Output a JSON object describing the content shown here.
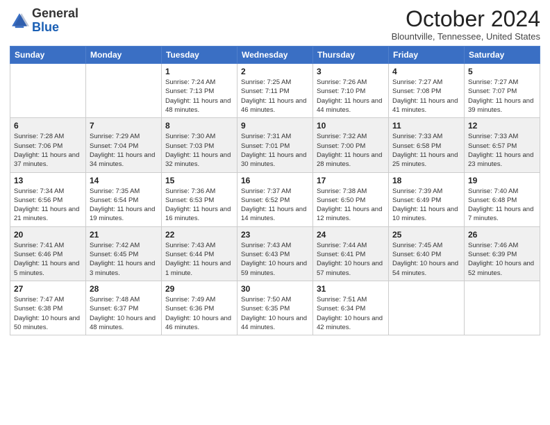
{
  "header": {
    "logo_general": "General",
    "logo_blue": "Blue",
    "month": "October 2024",
    "location": "Blountville, Tennessee, United States"
  },
  "weekdays": [
    "Sunday",
    "Monday",
    "Tuesday",
    "Wednesday",
    "Thursday",
    "Friday",
    "Saturday"
  ],
  "weeks": [
    [
      {
        "day": "",
        "info": ""
      },
      {
        "day": "",
        "info": ""
      },
      {
        "day": "1",
        "info": "Sunrise: 7:24 AM\nSunset: 7:13 PM\nDaylight: 11 hours and 48 minutes."
      },
      {
        "day": "2",
        "info": "Sunrise: 7:25 AM\nSunset: 7:11 PM\nDaylight: 11 hours and 46 minutes."
      },
      {
        "day": "3",
        "info": "Sunrise: 7:26 AM\nSunset: 7:10 PM\nDaylight: 11 hours and 44 minutes."
      },
      {
        "day": "4",
        "info": "Sunrise: 7:27 AM\nSunset: 7:08 PM\nDaylight: 11 hours and 41 minutes."
      },
      {
        "day": "5",
        "info": "Sunrise: 7:27 AM\nSunset: 7:07 PM\nDaylight: 11 hours and 39 minutes."
      }
    ],
    [
      {
        "day": "6",
        "info": "Sunrise: 7:28 AM\nSunset: 7:06 PM\nDaylight: 11 hours and 37 minutes."
      },
      {
        "day": "7",
        "info": "Sunrise: 7:29 AM\nSunset: 7:04 PM\nDaylight: 11 hours and 34 minutes."
      },
      {
        "day": "8",
        "info": "Sunrise: 7:30 AM\nSunset: 7:03 PM\nDaylight: 11 hours and 32 minutes."
      },
      {
        "day": "9",
        "info": "Sunrise: 7:31 AM\nSunset: 7:01 PM\nDaylight: 11 hours and 30 minutes."
      },
      {
        "day": "10",
        "info": "Sunrise: 7:32 AM\nSunset: 7:00 PM\nDaylight: 11 hours and 28 minutes."
      },
      {
        "day": "11",
        "info": "Sunrise: 7:33 AM\nSunset: 6:58 PM\nDaylight: 11 hours and 25 minutes."
      },
      {
        "day": "12",
        "info": "Sunrise: 7:33 AM\nSunset: 6:57 PM\nDaylight: 11 hours and 23 minutes."
      }
    ],
    [
      {
        "day": "13",
        "info": "Sunrise: 7:34 AM\nSunset: 6:56 PM\nDaylight: 11 hours and 21 minutes."
      },
      {
        "day": "14",
        "info": "Sunrise: 7:35 AM\nSunset: 6:54 PM\nDaylight: 11 hours and 19 minutes."
      },
      {
        "day": "15",
        "info": "Sunrise: 7:36 AM\nSunset: 6:53 PM\nDaylight: 11 hours and 16 minutes."
      },
      {
        "day": "16",
        "info": "Sunrise: 7:37 AM\nSunset: 6:52 PM\nDaylight: 11 hours and 14 minutes."
      },
      {
        "day": "17",
        "info": "Sunrise: 7:38 AM\nSunset: 6:50 PM\nDaylight: 11 hours and 12 minutes."
      },
      {
        "day": "18",
        "info": "Sunrise: 7:39 AM\nSunset: 6:49 PM\nDaylight: 11 hours and 10 minutes."
      },
      {
        "day": "19",
        "info": "Sunrise: 7:40 AM\nSunset: 6:48 PM\nDaylight: 11 hours and 7 minutes."
      }
    ],
    [
      {
        "day": "20",
        "info": "Sunrise: 7:41 AM\nSunset: 6:46 PM\nDaylight: 11 hours and 5 minutes."
      },
      {
        "day": "21",
        "info": "Sunrise: 7:42 AM\nSunset: 6:45 PM\nDaylight: 11 hours and 3 minutes."
      },
      {
        "day": "22",
        "info": "Sunrise: 7:43 AM\nSunset: 6:44 PM\nDaylight: 11 hours and 1 minute."
      },
      {
        "day": "23",
        "info": "Sunrise: 7:43 AM\nSunset: 6:43 PM\nDaylight: 10 hours and 59 minutes."
      },
      {
        "day": "24",
        "info": "Sunrise: 7:44 AM\nSunset: 6:41 PM\nDaylight: 10 hours and 57 minutes."
      },
      {
        "day": "25",
        "info": "Sunrise: 7:45 AM\nSunset: 6:40 PM\nDaylight: 10 hours and 54 minutes."
      },
      {
        "day": "26",
        "info": "Sunrise: 7:46 AM\nSunset: 6:39 PM\nDaylight: 10 hours and 52 minutes."
      }
    ],
    [
      {
        "day": "27",
        "info": "Sunrise: 7:47 AM\nSunset: 6:38 PM\nDaylight: 10 hours and 50 minutes."
      },
      {
        "day": "28",
        "info": "Sunrise: 7:48 AM\nSunset: 6:37 PM\nDaylight: 10 hours and 48 minutes."
      },
      {
        "day": "29",
        "info": "Sunrise: 7:49 AM\nSunset: 6:36 PM\nDaylight: 10 hours and 46 minutes."
      },
      {
        "day": "30",
        "info": "Sunrise: 7:50 AM\nSunset: 6:35 PM\nDaylight: 10 hours and 44 minutes."
      },
      {
        "day": "31",
        "info": "Sunrise: 7:51 AM\nSunset: 6:34 PM\nDaylight: 10 hours and 42 minutes."
      },
      {
        "day": "",
        "info": ""
      },
      {
        "day": "",
        "info": ""
      }
    ]
  ]
}
